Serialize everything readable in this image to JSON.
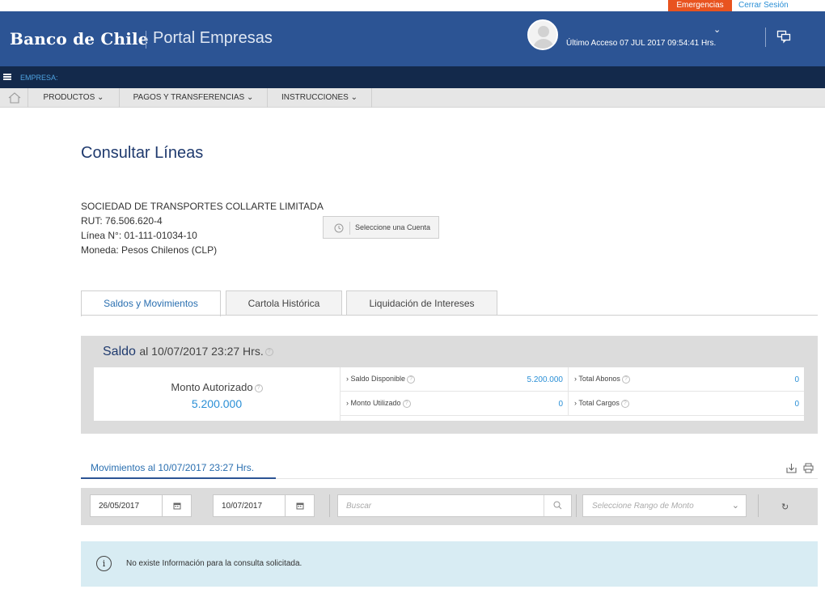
{
  "top": {
    "emergencias": "Emergencias",
    "logout": "Cerrar Sesión"
  },
  "header": {
    "logo": "Banco de Chile",
    "portal": "Portal Empresas",
    "last_access": "Último Acceso 07 JUL 2017 09:54:41 Hrs."
  },
  "empresa_label": "EMPRESA:",
  "menu": {
    "items": [
      "PRODUCTOS",
      "PAGOS Y TRANSFERENCIAS",
      "INSTRUCCIONES"
    ]
  },
  "page": {
    "title": "Consultar Líneas"
  },
  "account": {
    "company": "SOCIEDAD DE TRANSPORTES COLLARTE LIMITADA",
    "rut": "RUT: 76.506.620-4",
    "linea": "Línea N°: 01-111-01034-10",
    "moneda": "Moneda: Pesos Chilenos (CLP)",
    "select_button": "Seleccione una Cuenta"
  },
  "tabs": [
    {
      "label": "Saldos y Movimientos",
      "active": true
    },
    {
      "label": "Cartola Histórica",
      "active": false
    },
    {
      "label": "Liquidación de Intereses",
      "active": false
    }
  ],
  "saldo": {
    "title": "Saldo",
    "date": "al 10/07/2017 23:27 Hrs.",
    "monto_autorizado_label": "Monto Autorizado",
    "monto_autorizado_value": "5.200.000",
    "saldo_disponible_label": "Saldo Disponible",
    "saldo_disponible_value": "5.200.000",
    "monto_utilizado_label": "Monto Utilizado",
    "monto_utilizado_value": "0",
    "total_abonos_label": "Total Abonos",
    "total_abonos_value": "0",
    "total_cargos_label": "Total Cargos",
    "total_cargos_value": "0"
  },
  "movimientos": {
    "tab_label": "Movimientos al 10/07/2017 23:27 Hrs."
  },
  "filters": {
    "date_from": "26/05/2017",
    "date_to": "10/07/2017",
    "search_placeholder": "Buscar",
    "rango_placeholder": "Seleccione Rango de Monto"
  },
  "info": {
    "message": "No existe Información para la consulta solicitada."
  },
  "colors": {
    "header": "#2c5494",
    "empresa_bar": "#13294b",
    "emergency": "#e8531f",
    "link": "#2a8fd6",
    "info_bg": "#d8ecf3"
  },
  "icons": [
    "home-icon",
    "chat-icon",
    "menu-icon",
    "refresh-account-icon",
    "help-icon",
    "download-icon",
    "print-icon",
    "calendar-icon",
    "search-icon",
    "chevron-down-icon",
    "refresh-icon",
    "info-icon"
  ]
}
